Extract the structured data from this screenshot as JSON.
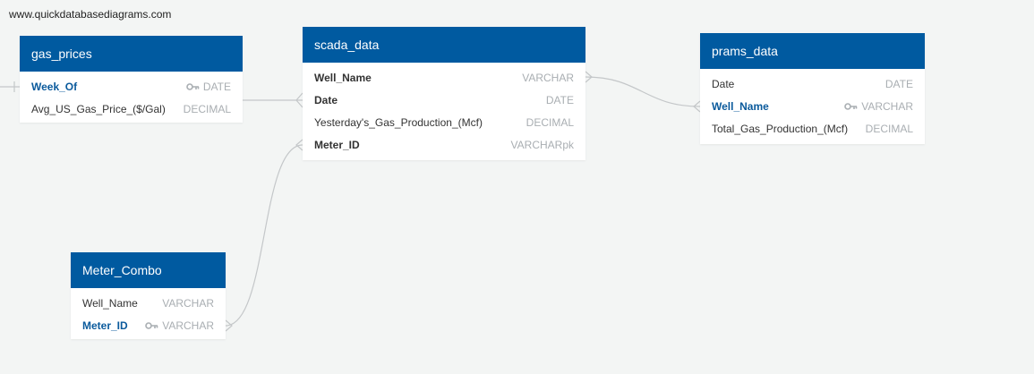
{
  "watermark": "www.quickdatabasediagrams.com",
  "tables": {
    "gas_prices": {
      "title": "gas_prices",
      "fields": [
        {
          "name": "Week_Of",
          "type": "DATE"
        },
        {
          "name": "Avg_US_Gas_Price_($/Gal)",
          "type": "DECIMAL"
        }
      ]
    },
    "scada_data": {
      "title": "scada_data",
      "fields": [
        {
          "name": "Well_Name",
          "type": "VARCHAR"
        },
        {
          "name": "Date",
          "type": "DATE"
        },
        {
          "name": "Yesterday's_Gas_Production_(Mcf)",
          "type": "DECIMAL"
        },
        {
          "name": "Meter_ID",
          "type": "VARCHARpk"
        }
      ]
    },
    "prams_data": {
      "title": "prams_data",
      "fields": [
        {
          "name": "Date",
          "type": "DATE"
        },
        {
          "name": "Well_Name",
          "type": "VARCHAR"
        },
        {
          "name": "Total_Gas_Production_(Mcf)",
          "type": "DECIMAL"
        }
      ]
    },
    "meter_combo": {
      "title": "Meter_Combo",
      "fields": [
        {
          "name": "Well_Name",
          "type": "VARCHAR"
        },
        {
          "name": "Meter_ID",
          "type": "VARCHAR"
        }
      ]
    }
  },
  "colors": {
    "header": "#005aa0",
    "primary_key_text": "#0a5a9c",
    "type_text": "#a9aeb2",
    "link_line": "#c4c7c9",
    "background": "#f3f5f4"
  }
}
